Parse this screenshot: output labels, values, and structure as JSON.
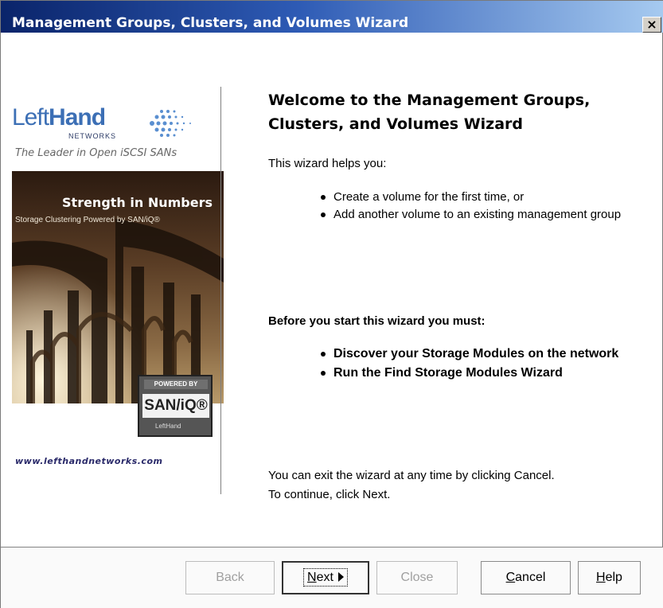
{
  "window": {
    "title": "Management Groups, Clusters, and Volumes Wizard",
    "close_label": "×"
  },
  "branding": {
    "logo_left": "Left",
    "logo_right": "Hand",
    "logo_sub": "NETWORKS",
    "tagline": "The Leader in Open iSCSI SANs",
    "headline": "Strength in Numbers",
    "subheadline": "Storage Clustering Powered by SAN/iQ®",
    "badge_top": "POWERED BY",
    "badge_main": "SAN/iQ®",
    "badge_bottom": "LeftHand",
    "url": "www.lefthandnetworks.com"
  },
  "content": {
    "heading_line1": "Welcome to the Management Groups,",
    "heading_line2": "Clusters, and Volumes Wizard",
    "intro": "This wizard helps you:",
    "helps": [
      "Create a volume for the first time, or",
      "Add another volume to an existing management group"
    ],
    "before_heading": "Before you start this wizard you must:",
    "requirements": [
      "Discover your Storage Modules on the network",
      "Run the Find Storage Modules Wizard"
    ],
    "exit_line1": "You can exit the wizard at any time by clicking Cancel.",
    "exit_line2": "To continue, click Next."
  },
  "buttons": {
    "back": "Back",
    "next": "Next",
    "close": "Close",
    "cancel_mnemonic": "C",
    "cancel_rest": "ancel",
    "help_mnemonic": "H",
    "help_rest": "elp",
    "next_mnemonic": "N",
    "next_rest": "ext"
  }
}
